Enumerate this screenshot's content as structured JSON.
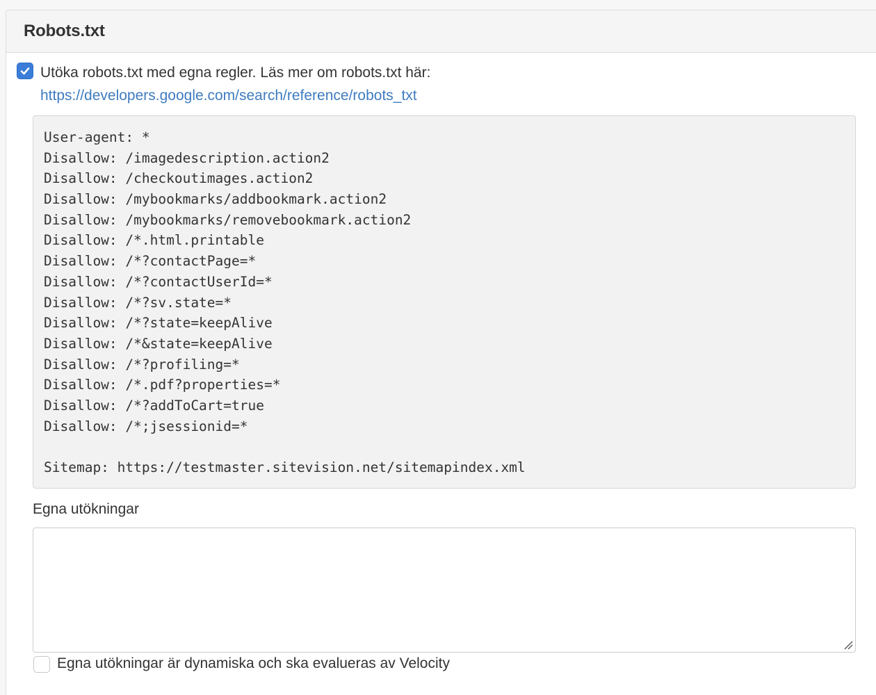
{
  "panel": {
    "title": "Robots.txt"
  },
  "extend_option": {
    "checked": true,
    "label": "Utöka robots.txt med egna regler. Läs mer om robots.txt här:",
    "link_text": "https://developers.google.com/search/reference/robots_txt"
  },
  "robots_preview": {
    "lines": [
      "User-agent: *",
      "Disallow: /imagedescription.action2",
      "Disallow: /checkoutimages.action2",
      "Disallow: /mybookmarks/addbookmark.action2",
      "Disallow: /mybookmarks/removebookmark.action2",
      "Disallow: /*.html.printable",
      "Disallow: /*?contactPage=*",
      "Disallow: /*?contactUserId=*",
      "Disallow: /*?sv.state=*",
      "Disallow: /*?state=keepAlive",
      "Disallow: /*&state=keepAlive",
      "Disallow: /*?profiling=*",
      "Disallow: /*.pdf?properties=*",
      "Disallow: /*?addToCart=true",
      "Disallow: /*;jsessionid=*",
      "",
      "Sitemap: https://testmaster.sitevision.net/sitemapindex.xml"
    ]
  },
  "custom_extensions": {
    "label": "Egna utökningar",
    "value": ""
  },
  "velocity_option": {
    "checked": false,
    "label": "Egna utökningar är dynamiska och ska evalueras av Velocity"
  },
  "colors": {
    "accent": "#3b7dd8",
    "link": "#3e7bbf",
    "code_background": "#f2f2f2"
  }
}
